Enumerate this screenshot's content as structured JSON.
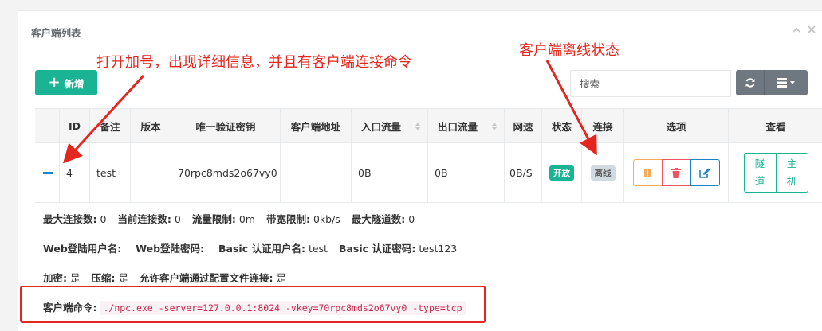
{
  "panel": {
    "title": "客户端列表"
  },
  "toolbar": {
    "add_label": "新增",
    "search_placeholder": "搜索"
  },
  "table": {
    "headers": [
      "ID",
      "备注",
      "版本",
      "唯一验证密钥",
      "客户端地址",
      "入口流量",
      "出口流量",
      "网速",
      "状态",
      "连接",
      "选项",
      "查看"
    ],
    "row": {
      "id": "4",
      "remark": "test",
      "version": "",
      "vkey": "70rpc8mds2o67vy0",
      "address": "",
      "in_flow": "0B",
      "out_flow": "0B",
      "speed": "0B/S",
      "status": "开放",
      "connection": "离线",
      "view_tunnel": "隧道",
      "view_host": "主机"
    }
  },
  "detail": {
    "line1": [
      {
        "label": "最大连接数:",
        "value": "0"
      },
      {
        "label": "当前连接数:",
        "value": "0"
      },
      {
        "label": "流量限制:",
        "value": "0m"
      },
      {
        "label": "带宽限制:",
        "value": "0kb/s"
      },
      {
        "label": "最大隧道数:",
        "value": "0"
      }
    ],
    "line2": [
      {
        "label": "Web登陆用户名:",
        "value": ""
      },
      {
        "label": "Web登陆密码:",
        "value": ""
      },
      {
        "label": "Basic 认证用户名:",
        "value": "test"
      },
      {
        "label": "Basic 认证密码:",
        "value": "test123"
      }
    ],
    "line3": [
      {
        "label": "加密:",
        "value": "是"
      },
      {
        "label": "压缩:",
        "value": "是"
      },
      {
        "label": "允许客户端通过配置文件连接:",
        "value": "是"
      }
    ],
    "command_label": "客户端命令:",
    "command": "./npc.exe -server=127.0.0.1:8024 -vkey=70rpc8mds2o67vy0 -type=tcp"
  },
  "annotations": {
    "left": "打开加号，出现详细信息，并且有客户端连接命令",
    "right": "客户端离线状态"
  },
  "colors": {
    "primary": "#1ab394",
    "warning": "#f8ac59",
    "danger": "#ed5565",
    "info": "#1c84c6",
    "annotation": "#e5261f"
  }
}
